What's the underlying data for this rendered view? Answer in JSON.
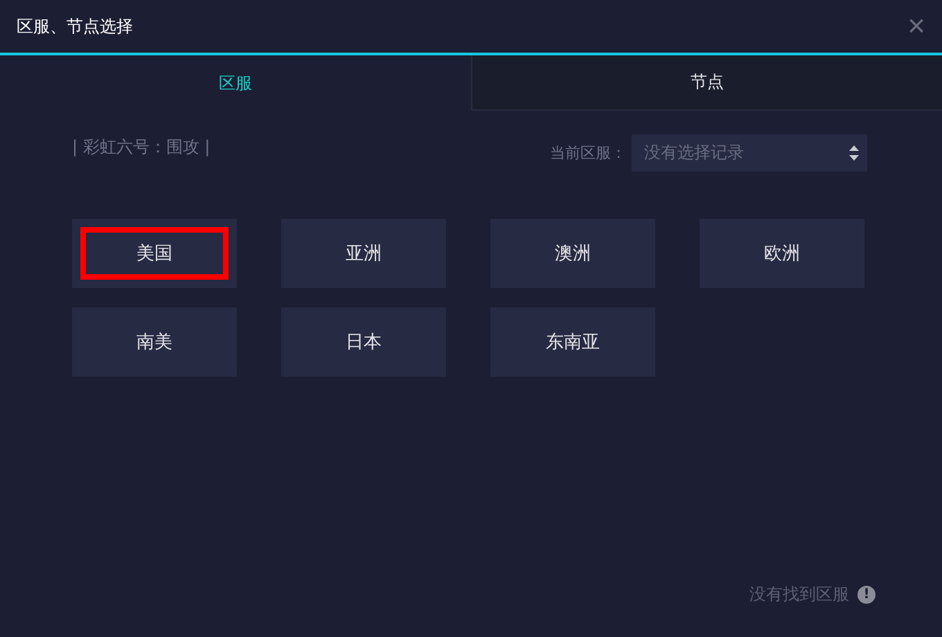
{
  "window": {
    "title": "区服、节点选择",
    "close": "×"
  },
  "tabs": [
    {
      "label": "区服",
      "selected": true
    },
    {
      "label": "节点",
      "selected": false
    }
  ],
  "game": "| 彩虹六号：围攻 |",
  "current": {
    "label": "当前区服：",
    "placeholder": "没有选择记录"
  },
  "regions": [
    {
      "label": "美国",
      "highlighted": true
    },
    {
      "label": "亚洲",
      "highlighted": false
    },
    {
      "label": "澳洲",
      "highlighted": false
    },
    {
      "label": "欧洲",
      "highlighted": false
    },
    {
      "label": "南美",
      "highlighted": false
    },
    {
      "label": "日本",
      "highlighted": false
    },
    {
      "label": "东南亚",
      "highlighted": false
    }
  ],
  "footer": {
    "text": "没有找到区服",
    "icon": "!"
  }
}
